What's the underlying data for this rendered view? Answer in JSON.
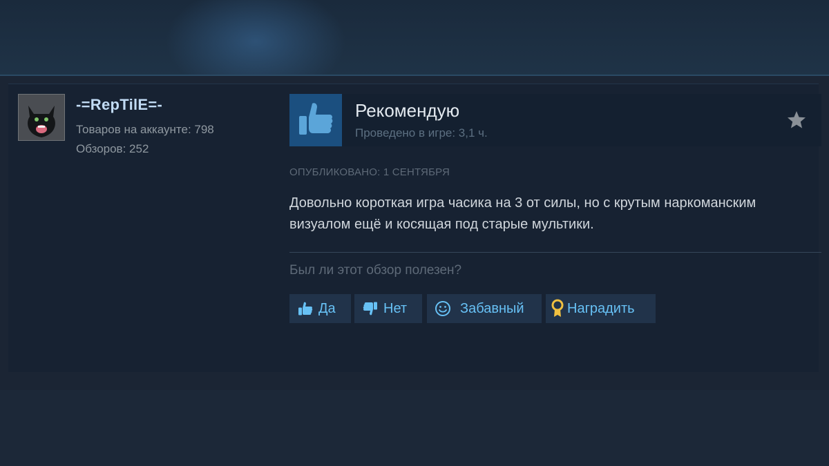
{
  "author": {
    "name": "-=RepTilE=-",
    "products_label": "Товаров на аккаунте: 798",
    "reviews_label": "Обзоров: 252"
  },
  "review": {
    "verdict": "Рекомендую",
    "hours": "Проведено в игре: 3,1 ч.",
    "posted": "ОПУБЛИКОВАНО: 1 СЕНТЯБРЯ",
    "text": "Довольно короткая игра часика на 3 от силы, но с крутым наркоманским визуалом ещё и косящая под старые мультики.",
    "helpful_question": "Был ли этот обзор полезен?"
  },
  "actions": {
    "yes": "Да",
    "no": "Нет",
    "funny": "Забавный",
    "award": "Наградить"
  },
  "icons": {
    "verdict": "thumbs-up-icon",
    "favorite": "star-icon",
    "yes": "thumbs-up-icon",
    "no": "thumbs-down-icon",
    "funny": "smiley-icon",
    "award": "award-icon"
  },
  "colors": {
    "background": "#1b2534",
    "card": "#172232",
    "link_blue": "#67c1f5",
    "button_bg": "#21334a",
    "thumb_box": "#1b4f7f",
    "award_gold": "#f0c040"
  }
}
